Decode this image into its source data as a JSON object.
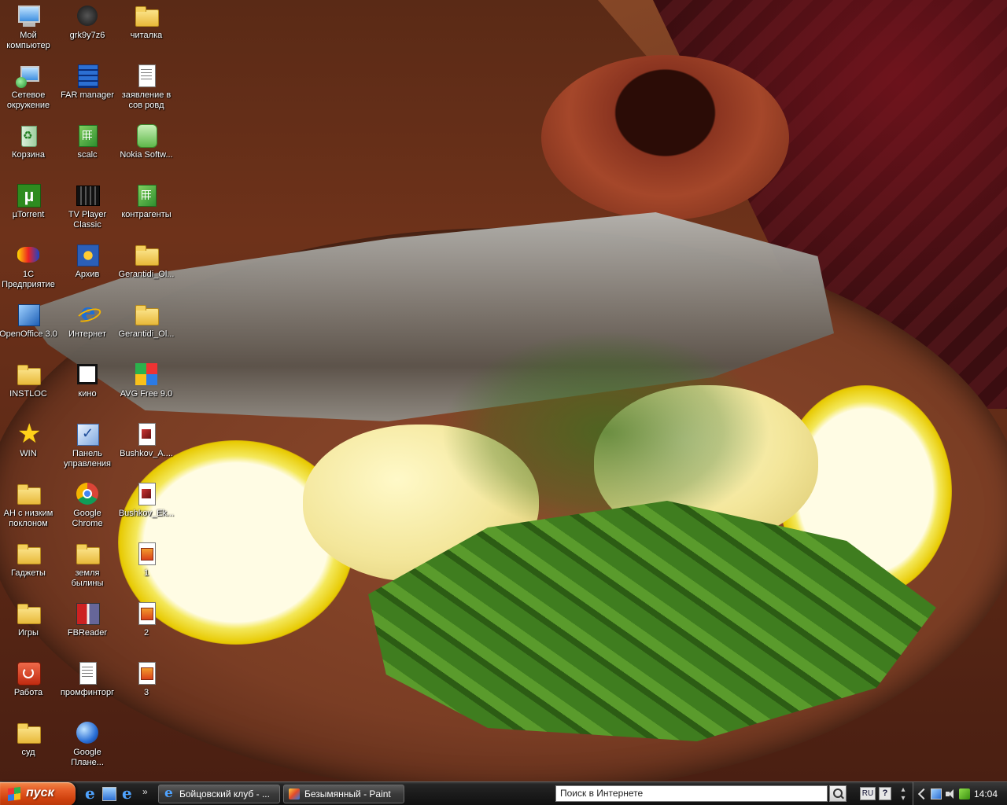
{
  "desktop": {
    "icons": [
      {
        "label": "Мой компьютер",
        "icon": "my-computer-icon"
      },
      {
        "label": "Сетевое окружение",
        "icon": "network-places-icon"
      },
      {
        "label": "Корзина",
        "icon": "recycle-bin-icon"
      },
      {
        "label": "µTorrent",
        "icon": "utorrent-icon"
      },
      {
        "label": "1С Предприятие",
        "icon": "1c-enterprise-icon"
      },
      {
        "label": "OpenOffice 3.0",
        "icon": "openoffice-icon"
      },
      {
        "label": "INSTLOC",
        "icon": "folder-icon"
      },
      {
        "label": "WIN",
        "icon": "star-icon"
      },
      {
        "label": "АН с низким поклоном",
        "icon": "folder-icon"
      },
      {
        "label": "Гаджеты",
        "icon": "folder-icon"
      },
      {
        "label": "Игры",
        "icon": "folder-icon"
      },
      {
        "label": "Работа",
        "icon": "power-icon"
      },
      {
        "label": "суд",
        "icon": "folder-icon"
      },
      {
        "label": "grk9y7z6",
        "icon": "dark-app-icon"
      },
      {
        "label": "FAR manager",
        "icon": "far-manager-icon"
      },
      {
        "label": "scalc",
        "icon": "spreadsheet-icon"
      },
      {
        "label": "TV Player Classic",
        "icon": "tv-player-icon"
      },
      {
        "label": "Архив",
        "icon": "archive-icon"
      },
      {
        "label": "Интернет",
        "icon": "internet-explorer-icon"
      },
      {
        "label": "кино",
        "icon": "movie-icon"
      },
      {
        "label": "Панель управления",
        "icon": "control-panel-icon"
      },
      {
        "label": "Google Chrome",
        "icon": "chrome-icon"
      },
      {
        "label": "земля былины",
        "icon": "folder-icon"
      },
      {
        "label": "FBReader",
        "icon": "fbreader-icon"
      },
      {
        "label": "промфинторг",
        "icon": "document-icon"
      },
      {
        "label": "Google Плане...",
        "icon": "google-earth-icon"
      },
      {
        "label": "читалка",
        "icon": "folder-icon"
      },
      {
        "label": "заявление в сов ровд",
        "icon": "document-icon"
      },
      {
        "label": "Nokia Softw...",
        "icon": "nokia-icon"
      },
      {
        "label": "контрагенты",
        "icon": "spreadsheet-icon"
      },
      {
        "label": "Gerantidi_Ol...",
        "icon": "folder-icon"
      },
      {
        "label": "Gerantidi_Ol...",
        "icon": "folder-icon"
      },
      {
        "label": "AVG Free 9.0",
        "icon": "avg-icon"
      },
      {
        "label": "Bushkov_A....",
        "icon": "pdf-document-icon"
      },
      {
        "label": "Bushkov_Ek...",
        "icon": "pdf-document-icon"
      },
      {
        "label": "1",
        "icon": "image-file-icon"
      },
      {
        "label": "2",
        "icon": "image-file-icon"
      },
      {
        "label": "3",
        "icon": "image-file-icon"
      }
    ]
  },
  "taskbar": {
    "start_label": "пуск",
    "quick_launch_more": "»",
    "tasks": [
      {
        "label": "Бойцовский клуб - ..."
      },
      {
        "label": "Безымянный - Paint"
      }
    ],
    "search_placeholder": "Поиск в Интернете",
    "language": "RU",
    "help": "?",
    "clock": "14:04"
  }
}
